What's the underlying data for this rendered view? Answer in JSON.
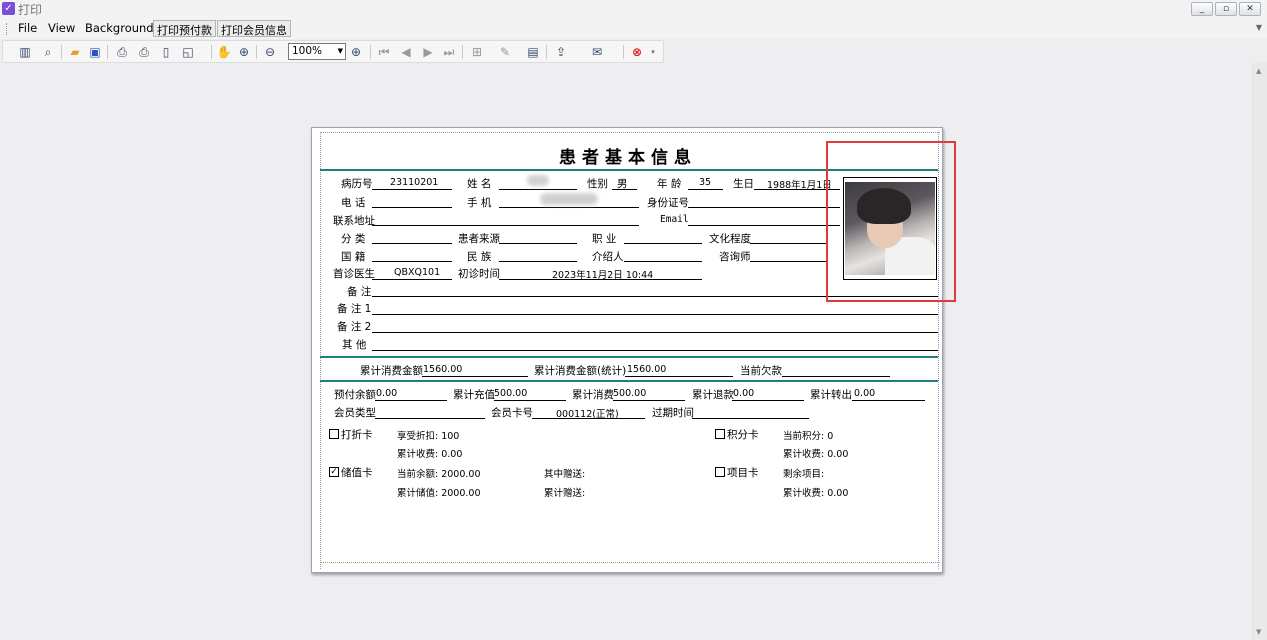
{
  "window": {
    "title": "打印"
  },
  "menu": {
    "items": [
      "File",
      "View",
      "Background"
    ],
    "tabs": [
      "打印预付款",
      "打印会员信息"
    ]
  },
  "toolbar": {
    "zoom": "100%"
  },
  "doc": {
    "title": "患者基本信息",
    "labels": {
      "record_no": "病历号",
      "name": "姓 名",
      "gender": "性别",
      "age": "年 龄",
      "birthday": "生日",
      "phone": "电 话",
      "mobile": "手 机",
      "id_no": "身份证号",
      "address": "联系地址",
      "email": "Email",
      "category": "分 类",
      "source": "患者来源",
      "job": "职 业",
      "education": "文化程度",
      "nationality": "国 籍",
      "ethnicity": "民 族",
      "referrer": "介绍人",
      "consultant": "咨询师",
      "first_doctor": "首诊医生",
      "first_visit": "初诊时间",
      "note": "备 注",
      "note1": "备 注 1",
      "note2": "备 注 2",
      "other": "其 他"
    },
    "values": {
      "record_no": "23110201",
      "gender": "男",
      "age": "35",
      "birthday": "1988年1月1日",
      "first_doctor": "QBXQ101",
      "first_visit": "2023年11月2日 10:44"
    },
    "summary": {
      "total_consume_label": "累计消费金额",
      "total_consume": "1560.00",
      "total_consume_stat_label": "累计消费金额(统计)",
      "total_consume_stat": "1560.00",
      "arrears_label": "当前欠款"
    },
    "account": {
      "prepay_label": "预付余额",
      "prepay": "0.00",
      "recharge_label": "累计充值",
      "recharge": "500.00",
      "consume_label": "累计消费",
      "consume": "500.00",
      "refund_label": "累计退款",
      "refund": "0.00",
      "transfer_label": "累计转出",
      "transfer": "0.00",
      "member_type_label": "会员类型",
      "card_no_label": "会员卡号",
      "card_no": "000112(正常)",
      "expire_label": "过期时间"
    },
    "cards": {
      "discount": {
        "label": "打折卡",
        "checked": "no",
        "line1": "享受折扣: 100",
        "line2": "累计收费: 0.00"
      },
      "points": {
        "label": "积分卡",
        "checked": "no",
        "line1": "当前积分: 0",
        "line2": "累计收费: 0.00"
      },
      "stored": {
        "label": "储值卡",
        "checked": "yes",
        "line1": "当前余额: 2000.00",
        "line2": "累计储值: 2000.00",
        "line3": "其中赠送:",
        "line4": "累计赠送:"
      },
      "project": {
        "label": "项目卡",
        "checked": "no",
        "line1": "剩余项目:",
        "line2": "累计收费: 0.00"
      }
    }
  }
}
